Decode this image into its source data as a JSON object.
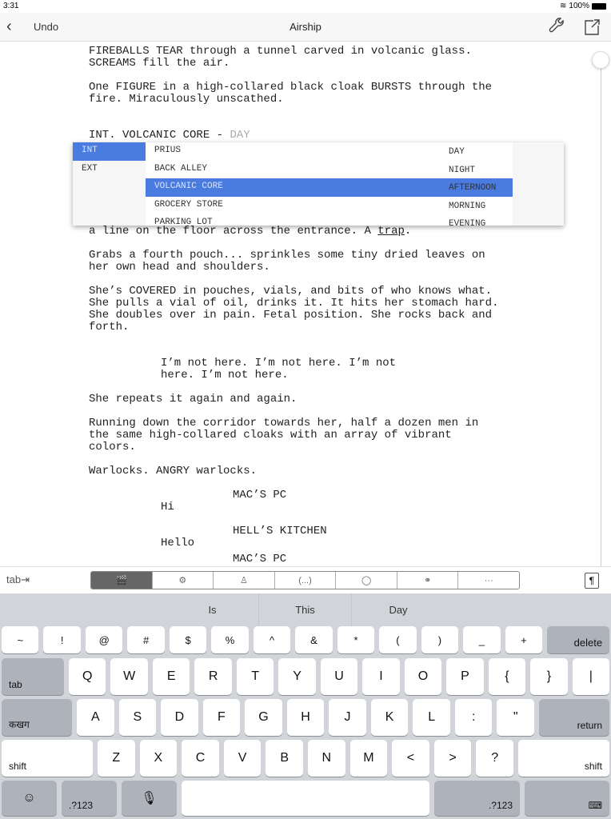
{
  "status": {
    "time": "3:31",
    "battery": "100%"
  },
  "nav": {
    "back_icon": "chevron-left-icon",
    "undo": "Undo",
    "title": "Airship",
    "wrench_icon": "wrench-icon",
    "share_icon": "share-icon"
  },
  "script": [
    {
      "type": "action",
      "lines": [
        "FIREBALLS TEAR through a tunnel carved in volcanic glass.",
        "SCREAMS fill the air."
      ]
    },
    {
      "type": "action",
      "lines": [
        "One FIGURE in a high-collared black cloak BURSTS through the",
        "fire. Miraculously unscathed."
      ]
    },
    {
      "type": "heading",
      "text": "INT. VOLCANIC CORE - ",
      "suggest": "DAY"
    },
    {
      "type": "action",
      "lines": [
        "a line on the floor across the entrance. A "
      ],
      "underlined": "trap",
      "end": "."
    },
    {
      "type": "action",
      "lines": [
        "Grabs a fourth pouch... sprinkles some tiny dried leaves on",
        "her own head and shoulders."
      ]
    },
    {
      "type": "action",
      "lines": [
        "She’s COVERED in pouches, vials, and bits of who knows what.",
        "She pulls a vial of oil, drinks it. It hits her stomach hard.",
        "She doubles over in pain. Fetal position. She rocks back and",
        "forth."
      ]
    },
    {
      "type": "dialogue",
      "lines": [
        "I’m not here. I’m not here. I’m not",
        "here. I’m not here."
      ]
    },
    {
      "type": "action",
      "lines": [
        "She repeats it again and again."
      ]
    },
    {
      "type": "action",
      "lines": [
        "Running down the corridor towards her, half a dozen men in",
        "the same high-collared cloaks with an array of vibrant",
        "colors."
      ]
    },
    {
      "type": "action",
      "lines": [
        "Warlocks. ANGRY warlocks."
      ]
    },
    {
      "type": "character",
      "text": "MAC’S PC"
    },
    {
      "type": "dialogue",
      "lines": [
        "Hi"
      ]
    },
    {
      "type": "character",
      "text": "HELL’S KITCHEN"
    },
    {
      "type": "dialogue",
      "lines": [
        "Hello"
      ]
    },
    {
      "type": "character",
      "text": "MAC’S PC"
    }
  ],
  "popup": {
    "int_ext": [
      "INT",
      "EXT"
    ],
    "selected_int_ext": "INT",
    "locations": [
      "PRIUS",
      "BACK ALLEY",
      "VOLCANIC CORE",
      "GROCERY STORE",
      "PARKING LOT"
    ],
    "selected_location": "VOLCANIC CORE",
    "times": [
      "DAY",
      "NIGHT",
      "AFTERNOON",
      "MORNING",
      "EVENING"
    ],
    "highlight_color": "#4a7bdf"
  },
  "accessory": {
    "tab": "tab⇥",
    "segments": [
      "scene-heading-icon",
      "gear-icon",
      "character-icon",
      "parenthetical-icon",
      "dialogue-icon",
      "transition-icon",
      "more-icon"
    ],
    "segment_glyphs": [
      "🎬",
      "⚙",
      "♙",
      "(...)",
      "◯",
      "⚭",
      "···"
    ],
    "selected_segment": 0,
    "paragraph_icon": "¶"
  },
  "keyboard": {
    "suggestions": [
      "Is",
      "This",
      "Day"
    ],
    "row1": [
      "~",
      "!",
      "@",
      "#",
      "$",
      "%",
      "^",
      "&",
      "*",
      "(",
      ")",
      "_",
      "+"
    ],
    "delete": "delete",
    "tab": "tab",
    "row2": [
      "Q",
      "W",
      "E",
      "R",
      "T",
      "Y",
      "U",
      "I",
      "O",
      "P",
      "{",
      "}",
      "|"
    ],
    "lang": "कखग",
    "row3": [
      "A",
      "S",
      "D",
      "F",
      "G",
      "H",
      "J",
      "K",
      "L",
      ":",
      "\""
    ],
    "return": "return",
    "shift": "shift",
    "row4": [
      "Z",
      "X",
      "C",
      "V",
      "B",
      "N",
      "M",
      "<",
      ">",
      "?"
    ],
    "emoji": "☺",
    "numbers": ".?123",
    "mic": "🎙",
    "hide": "⌨"
  }
}
